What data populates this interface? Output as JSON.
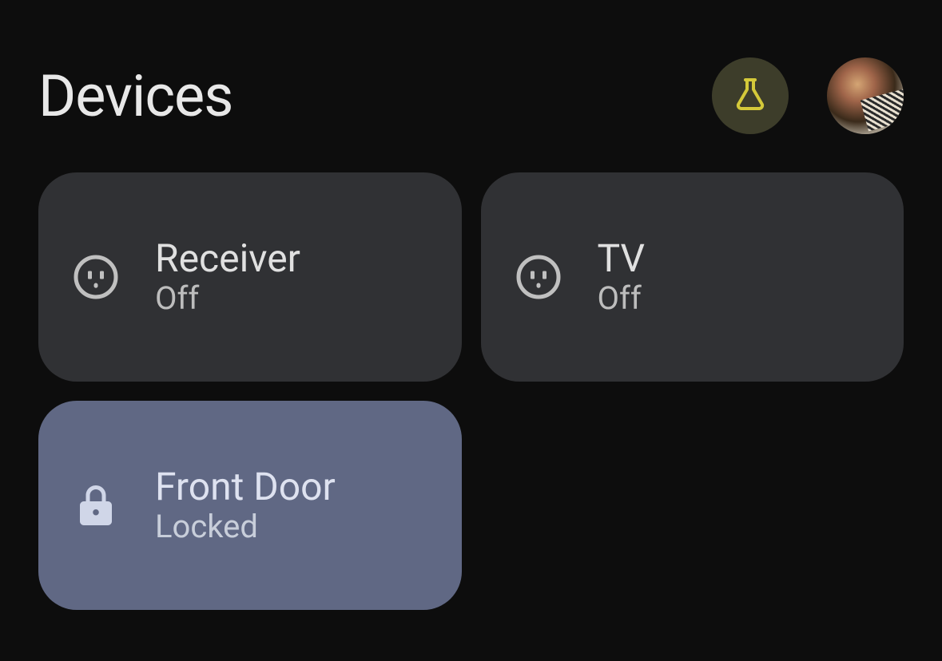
{
  "header": {
    "title": "Devices"
  },
  "devices": [
    {
      "name": "Receiver",
      "status": "Off",
      "icon": "outlet",
      "active": false
    },
    {
      "name": "TV",
      "status": "Off",
      "icon": "outlet",
      "active": false
    },
    {
      "name": "Front Door",
      "status": "Locked",
      "icon": "lock",
      "active": true
    }
  ]
}
